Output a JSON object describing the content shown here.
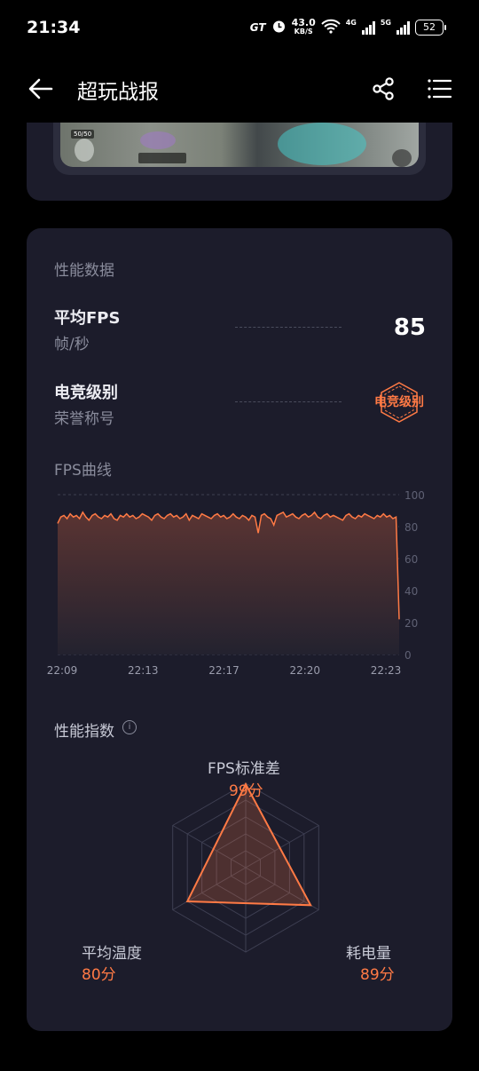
{
  "status_bar": {
    "time": "21:34",
    "gt_label": "GT",
    "speed_value": "43.0",
    "speed_unit": "KB/S",
    "network_4g": "4G",
    "network_5g": "5G",
    "battery": "52"
  },
  "header": {
    "title": "超玩战报",
    "back_icon": "arrow-left-icon",
    "share_icon": "share-icon",
    "menu_icon": "list-menu-icon"
  },
  "screenshot": {
    "hud_score": "50/50"
  },
  "performance": {
    "section_title": "性能数据",
    "avg_fps_label": "平均FPS",
    "avg_fps_unit": "帧/秒",
    "avg_fps_value": "85",
    "esports_label": "电竞级别",
    "esports_sub": "荣誉称号",
    "esports_badge": "电竞级别",
    "fps_curve_label": "FPS曲线",
    "index_title": "性能指数",
    "info_icon": "info-icon"
  },
  "chart_data": {
    "type": "area",
    "title": "FPS曲线",
    "x_ticks": [
      "22:09",
      "22:13",
      "22:17",
      "22:20",
      "22:23"
    ],
    "y_ticks": [
      "100",
      "80",
      "60",
      "40",
      "20",
      "0"
    ],
    "ylim": [
      0,
      100
    ],
    "series": [
      {
        "values": [
          82,
          86,
          87,
          85,
          88,
          86,
          87,
          85,
          89,
          86,
          84,
          87,
          88,
          86,
          85,
          87,
          86,
          88,
          85,
          84,
          87,
          86,
          88,
          86,
          87,
          85,
          86,
          88,
          87,
          86,
          84,
          87,
          88,
          86,
          85,
          87,
          88,
          86,
          87,
          85,
          86,
          88,
          84,
          87,
          86,
          85,
          88,
          87,
          86,
          85,
          87,
          88,
          86,
          87,
          85,
          86,
          88,
          86,
          85,
          87,
          86,
          84,
          87,
          86,
          76,
          87,
          88,
          86,
          85,
          81,
          87,
          88,
          89,
          86,
          87,
          88,
          86,
          85,
          87,
          88,
          86,
          87,
          89,
          86,
          85,
          87,
          88,
          86,
          87,
          86,
          85,
          84,
          87,
          88,
          86,
          85,
          87,
          86,
          88,
          87,
          86,
          85,
          87,
          86,
          88,
          86,
          87,
          85,
          86,
          22
        ]
      }
    ],
    "colors": {
      "line": "#ff7a45",
      "fill_top": "#5a3432",
      "fill_bottom": "#23222f"
    }
  },
  "radar": {
    "axes": [
      {
        "label": "FPS标准差",
        "score": "99分",
        "value": 99
      },
      {
        "label": "耗电量",
        "score": "89分",
        "value": 89
      },
      {
        "label": "平均温度",
        "score": "80分",
        "value": 80
      }
    ],
    "max": 100
  }
}
